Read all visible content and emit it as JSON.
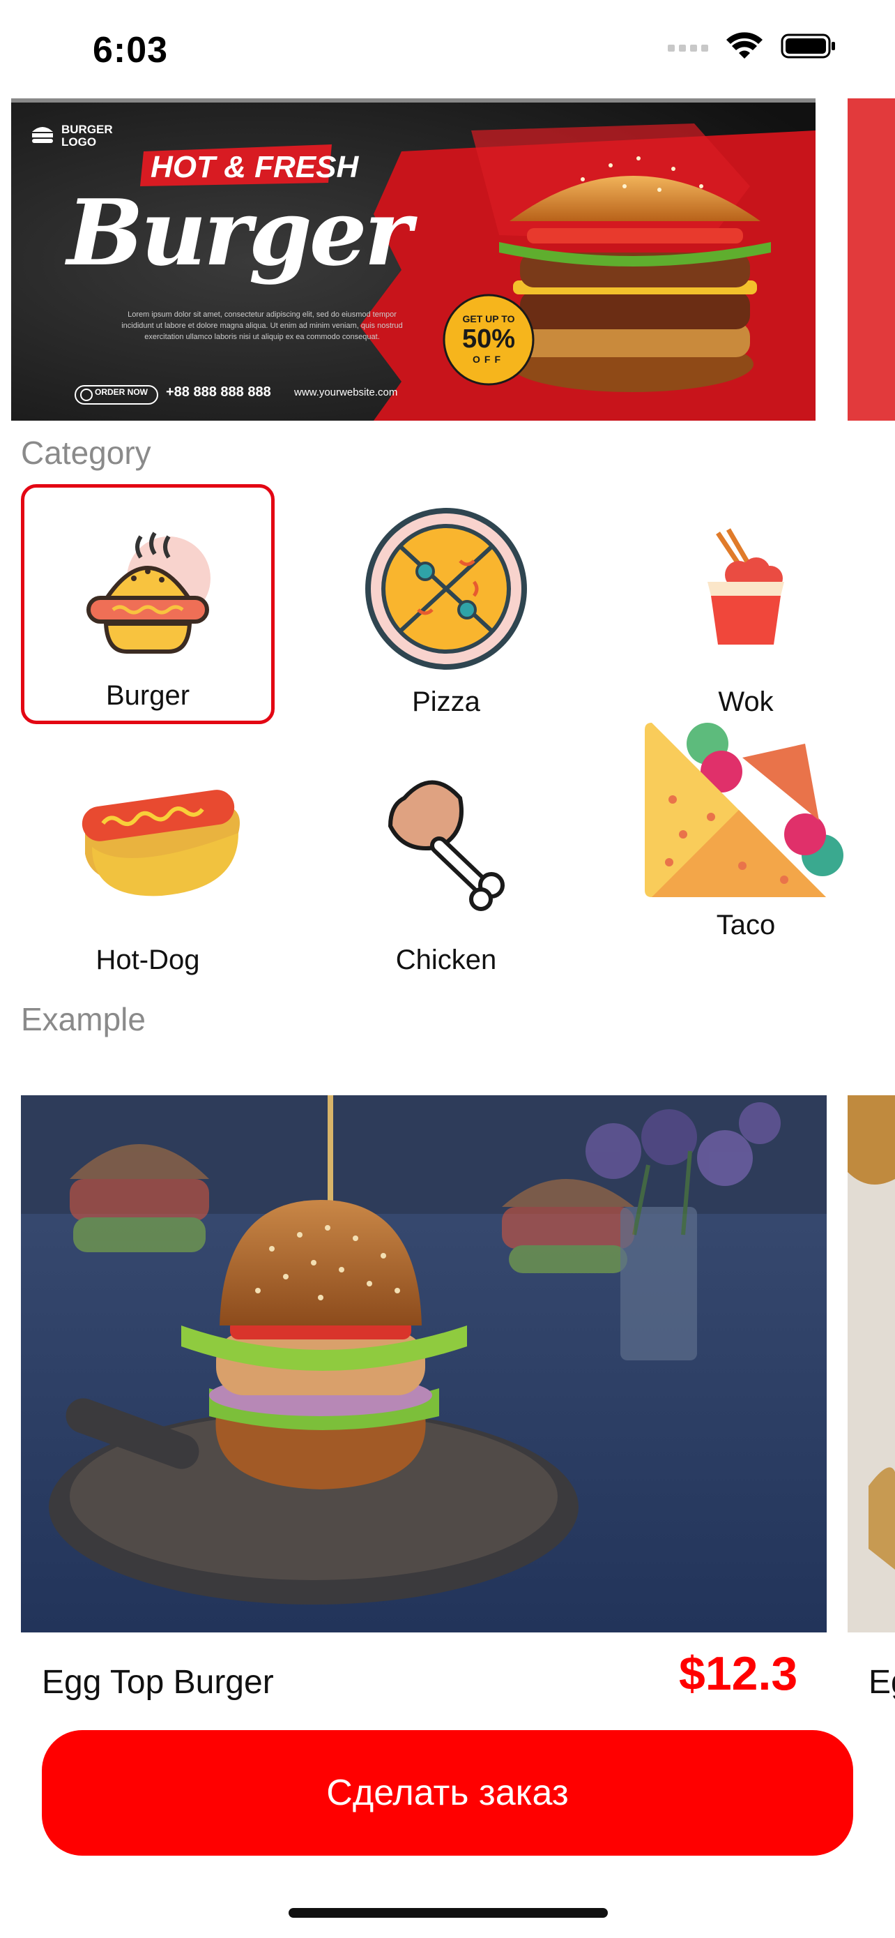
{
  "status": {
    "time": "6:03"
  },
  "banner": {
    "logo": "BURGER LOGO",
    "tagline": "HOT & FRESH",
    "headline": "Burger",
    "body": "Lorem ipsum dolor sit amet, consectetur adipiscing elit, sed do eiusmod tempor incididunt ut labore et dolore magna aliqua. Ut enim ad minim veniam, quis nostrud exercitation ullamco laboris nisi ut aliquip ex ea commodo consequat.",
    "order_now": "ORDER NOW",
    "phone": "+88 888 888 888",
    "website": "www.yourwebsite.com",
    "badge_top": "GET UP TO",
    "badge_value": "50%",
    "badge_bottom": "OFF"
  },
  "category": {
    "title": "Category",
    "items": [
      {
        "label": "Burger",
        "icon": "burger-icon",
        "selected": true
      },
      {
        "label": "Pizza",
        "icon": "pizza-icon",
        "selected": false
      },
      {
        "label": "Wok",
        "icon": "wok-icon",
        "selected": false
      },
      {
        "label": "Hot-Dog",
        "icon": "hotdog-icon",
        "selected": false
      },
      {
        "label": "Chicken",
        "icon": "chicken-leg-icon",
        "selected": false
      },
      {
        "label": "Taco",
        "icon": "taco-icon",
        "selected": false
      }
    ]
  },
  "example": {
    "title": "Example",
    "products": [
      {
        "name": "Egg Top Burger",
        "price": "$12.3"
      },
      {
        "name": "Eg"
      }
    ]
  },
  "order_button": {
    "label": "Сделать заказ"
  },
  "colors": {
    "accent": "#ff0000",
    "selected_border": "#e30613",
    "label_gray": "#8a8a8a"
  }
}
